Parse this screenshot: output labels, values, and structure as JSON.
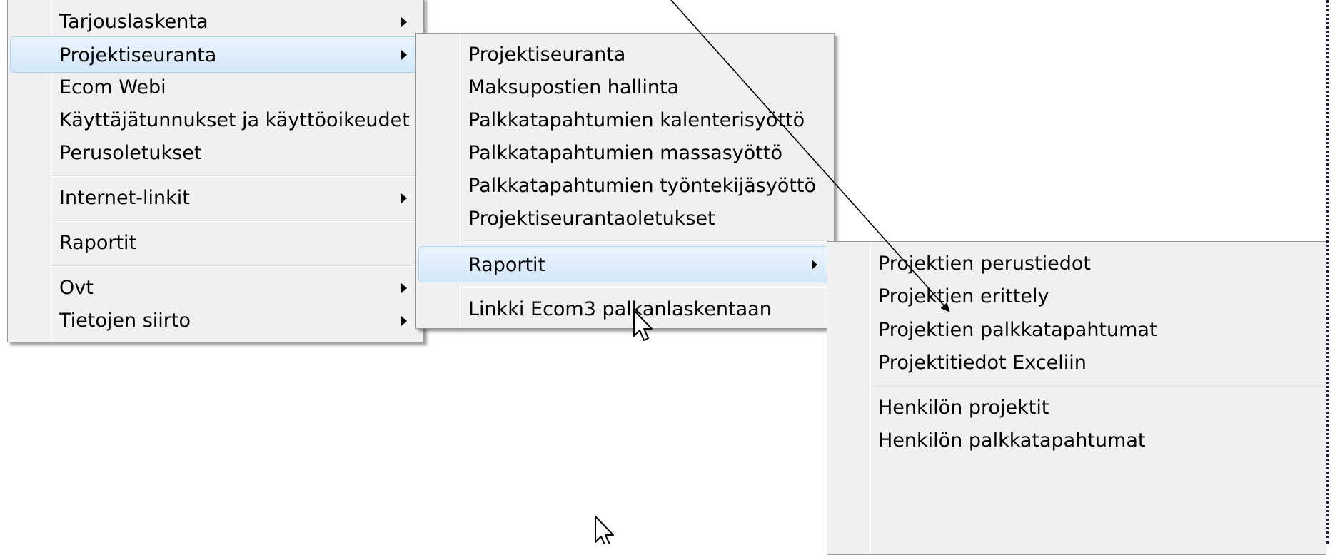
{
  "main_menu": {
    "items": [
      {
        "label": "Tarjouslaskenta",
        "has_submenu": true
      },
      {
        "label": "Projektiseuranta",
        "has_submenu": true,
        "highlighted": true
      },
      {
        "label": "Ecom Webi",
        "has_submenu": false
      },
      {
        "label": "Käyttäjätunnukset ja käyttöoikeudet",
        "has_submenu": false
      },
      {
        "label": "Perusoletukset",
        "has_submenu": false
      },
      {
        "label": "Internet-linkit",
        "has_submenu": true
      },
      {
        "label": "Raportit",
        "has_submenu": false
      },
      {
        "label": "Ovt",
        "has_submenu": true
      },
      {
        "label": "Tietojen siirto",
        "has_submenu": true
      }
    ]
  },
  "projektiseuranta_menu": {
    "items": [
      {
        "label": "Projektiseuranta",
        "has_submenu": false
      },
      {
        "label": "Maksupostien hallinta",
        "has_submenu": false
      },
      {
        "label": "Palkkatapahtumien kalenterisyöttö",
        "has_submenu": false
      },
      {
        "label": "Palkkatapahtumien massasyöttö",
        "has_submenu": false
      },
      {
        "label": "Palkkatapahtumien työntekijäsyöttö",
        "has_submenu": false
      },
      {
        "label": "Projektiseurantaoletukset",
        "has_submenu": false
      },
      {
        "label": "Raportit",
        "has_submenu": true,
        "highlighted": true
      },
      {
        "label": "Linkki Ecom3 palkanlaskentaan",
        "has_submenu": false
      }
    ]
  },
  "raportit_menu": {
    "items": [
      {
        "label": "Projektien perustiedot"
      },
      {
        "label": "Projektien erittely"
      },
      {
        "label": "Projektien palkkatapahtumat"
      },
      {
        "label": "Projektitiedot Exceliin"
      },
      {
        "label": "Henkilön projektit"
      },
      {
        "label": "Henkilön palkkatapahtumat"
      }
    ]
  },
  "colors": {
    "menu_background": "#f0f0f0",
    "menu_border": "#979797",
    "highlight_border": "#a8d8f7",
    "highlight_fill": "#d3e7fa"
  },
  "icons": {
    "submenu_arrow": "chevron-right-icon",
    "cursor": "mouse-pointer-icon",
    "annotation": "annotation-arrow"
  }
}
